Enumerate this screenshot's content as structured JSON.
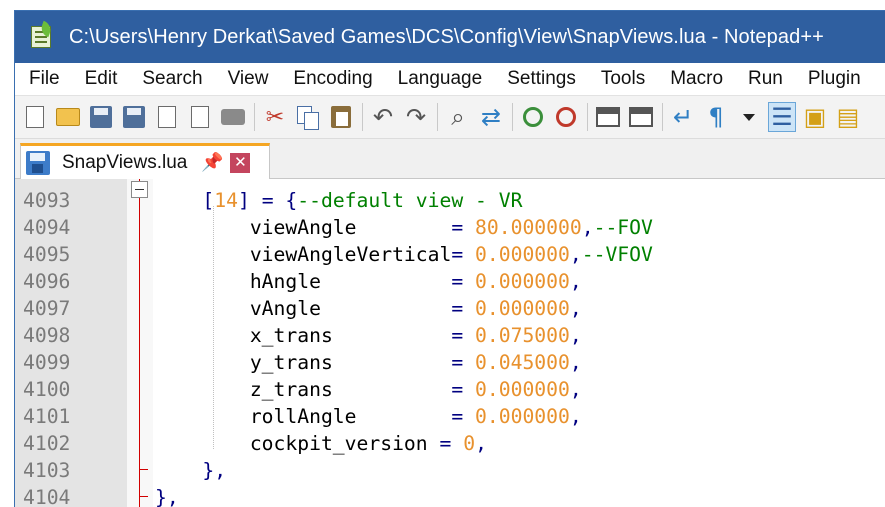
{
  "window": {
    "title": "C:\\Users\\Henry Derkat\\Saved Games\\DCS\\Config\\View\\SnapViews.lua - Notepad++"
  },
  "menu": [
    "File",
    "Edit",
    "Search",
    "View",
    "Encoding",
    "Language",
    "Settings",
    "Tools",
    "Macro",
    "Run",
    "Plugin"
  ],
  "toolbar": {
    "icons": [
      "new-file-icon",
      "open-folder-icon",
      "save-icon",
      "save-all-icon",
      "close-icon",
      "close-all-icon",
      "print-icon",
      "cut-icon",
      "copy-icon",
      "paste-icon",
      "undo-icon",
      "redo-icon",
      "find-icon",
      "replace-icon",
      "zoom-in-icon",
      "zoom-out-icon",
      "sync-vertical-icon",
      "sync-horizontal-icon",
      "word-wrap-icon",
      "show-all-characters-icon",
      "dropdown-icon",
      "indent-guide-icon",
      "function-list-icon",
      "folder-as-workspace-icon"
    ]
  },
  "tab": {
    "label": "SnapViews.lua",
    "pin": "📌",
    "close": "✕"
  },
  "editor": {
    "lines": [
      {
        "num": "4093",
        "indent": "    ",
        "parts": [
          {
            "t": "[",
            "c": "op"
          },
          {
            "t": "14",
            "c": "num"
          },
          {
            "t": "] = {",
            "c": "op"
          },
          {
            "t": "--default view - VR",
            "c": "cm"
          }
        ]
      },
      {
        "num": "4094",
        "indent": "        ",
        "parts": [
          {
            "t": "viewAngle        ",
            "c": "id"
          },
          {
            "t": "= ",
            "c": "op"
          },
          {
            "t": "80.000000",
            "c": "num"
          },
          {
            "t": ",",
            "c": "op"
          },
          {
            "t": "--FOV",
            "c": "cm"
          }
        ]
      },
      {
        "num": "4095",
        "indent": "        ",
        "parts": [
          {
            "t": "viewAngleVertical",
            "c": "id"
          },
          {
            "t": "= ",
            "c": "op"
          },
          {
            "t": "0.000000",
            "c": "num"
          },
          {
            "t": ",",
            "c": "op"
          },
          {
            "t": "--VFOV",
            "c": "cm"
          }
        ]
      },
      {
        "num": "4096",
        "indent": "        ",
        "parts": [
          {
            "t": "hAngle           ",
            "c": "id"
          },
          {
            "t": "= ",
            "c": "op"
          },
          {
            "t": "0.000000",
            "c": "num"
          },
          {
            "t": ",",
            "c": "op"
          }
        ]
      },
      {
        "num": "4097",
        "indent": "        ",
        "parts": [
          {
            "t": "vAngle           ",
            "c": "id"
          },
          {
            "t": "= ",
            "c": "op"
          },
          {
            "t": "0.000000",
            "c": "num"
          },
          {
            "t": ",",
            "c": "op"
          }
        ]
      },
      {
        "num": "4098",
        "indent": "        ",
        "parts": [
          {
            "t": "x_trans          ",
            "c": "id"
          },
          {
            "t": "= ",
            "c": "op"
          },
          {
            "t": "0.075000",
            "c": "num"
          },
          {
            "t": ",",
            "c": "op"
          }
        ]
      },
      {
        "num": "4099",
        "indent": "        ",
        "parts": [
          {
            "t": "y_trans          ",
            "c": "id"
          },
          {
            "t": "= ",
            "c": "op"
          },
          {
            "t": "0.045000",
            "c": "num"
          },
          {
            "t": ",",
            "c": "op"
          }
        ]
      },
      {
        "num": "4100",
        "indent": "        ",
        "parts": [
          {
            "t": "z_trans          ",
            "c": "id"
          },
          {
            "t": "= ",
            "c": "op"
          },
          {
            "t": "0.000000",
            "c": "num"
          },
          {
            "t": ",",
            "c": "op"
          }
        ]
      },
      {
        "num": "4101",
        "indent": "        ",
        "parts": [
          {
            "t": "rollAngle        ",
            "c": "id"
          },
          {
            "t": "= ",
            "c": "op"
          },
          {
            "t": "0.000000",
            "c": "num"
          },
          {
            "t": ",",
            "c": "op"
          }
        ]
      },
      {
        "num": "4102",
        "indent": "        ",
        "parts": [
          {
            "t": "cockpit_version ",
            "c": "id"
          },
          {
            "t": "= ",
            "c": "op"
          },
          {
            "t": "0",
            "c": "num"
          },
          {
            "t": ",",
            "c": "op"
          }
        ]
      },
      {
        "num": "4103",
        "indent": "    ",
        "parts": [
          {
            "t": "},",
            "c": "op"
          }
        ]
      },
      {
        "num": "4104",
        "indent": "",
        "parts": [
          {
            "t": "},",
            "c": "op"
          }
        ]
      }
    ]
  },
  "colors": {
    "titlebar": "#2f5fa0",
    "tab_accent": "#f5a623",
    "number": "#e8912d",
    "operator": "#000080",
    "comment": "#008000",
    "fold_line": "#d10000"
  }
}
